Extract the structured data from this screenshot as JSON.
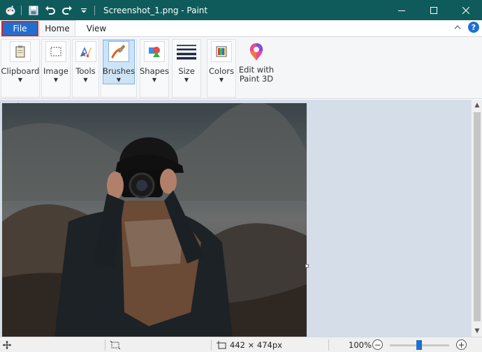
{
  "window": {
    "title": "Screenshot_1.png - Paint"
  },
  "tabs": [
    {
      "label": "File"
    },
    {
      "label": "Home"
    },
    {
      "label": "View"
    }
  ],
  "ribbon": {
    "tools": [
      {
        "label": "Clipboard",
        "icon": "clipboard-icon"
      },
      {
        "label": "Image",
        "icon": "select-icon"
      },
      {
        "label": "Tools",
        "icon": "tools-icon"
      },
      {
        "label": "Brushes",
        "icon": "brush-icon"
      },
      {
        "label": "Shapes",
        "icon": "shapes-icon"
      },
      {
        "label": "Size",
        "icon": "size-icon"
      },
      {
        "label": "Colors",
        "icon": "colors-icon"
      },
      {
        "label": "Edit with Paint 3D",
        "icon": "paint3d-icon"
      }
    ],
    "active_tool": "Brushes"
  },
  "status": {
    "dimensions": "442 × 474px",
    "zoom": "100%",
    "zoom_level": 1.0
  },
  "colors": {
    "titlebar": "#0f5b5c",
    "file_tab": "#1f6fd1",
    "highlight_border": "#e02020",
    "workspace": "#d5dde9"
  }
}
